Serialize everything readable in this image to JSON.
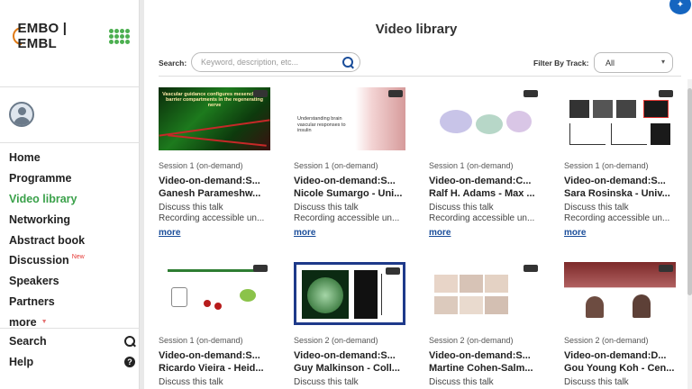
{
  "brand": {
    "logo_text": "EMBO | EMBL"
  },
  "sidebar": {
    "items": [
      {
        "label": "Home"
      },
      {
        "label": "Programme"
      },
      {
        "label": "Video library",
        "active": true
      },
      {
        "label": "Networking"
      },
      {
        "label": "Abstract book"
      },
      {
        "label": "Discussion",
        "badge": "New"
      },
      {
        "label": "Speakers"
      },
      {
        "label": "Partners"
      },
      {
        "label": "more"
      }
    ],
    "search_label": "Search",
    "help_label": "Help",
    "help_icon_glyph": "?"
  },
  "header": {
    "title": "Video library",
    "search_label": "Search:",
    "search_placeholder": "Keyword, description, etc...",
    "search_value": "",
    "filter_label": "Filter By Track:",
    "filter_value": "All"
  },
  "videos": [
    {
      "session": "Session 1 (on-demand)",
      "title": "Video-on-demand:S...",
      "speaker": "Ganesh Parameshw...",
      "discuss": "Discuss this talk",
      "access": "Recording accessible un...",
      "more": "more",
      "thumb_text": "Vascular guidance configures mesenchymal barrier compartments in the regenerating nerve"
    },
    {
      "session": "Session 1 (on-demand)",
      "title": "Video-on-demand:S...",
      "speaker": "Nicole Sumargo - Uni...",
      "discuss": "Discuss this talk",
      "access": "Recording accessible un...",
      "more": "more",
      "thumb_text": "Understanding brain vascular responses to insulin"
    },
    {
      "session": "Session 1 (on-demand)",
      "title": "Video-on-demand:C...",
      "speaker": "Ralf H. Adams - Max ...",
      "discuss": "Discuss this talk",
      "access": "Recording accessible un...",
      "more": "more",
      "thumb_text": ""
    },
    {
      "session": "Session 1 (on-demand)",
      "title": "Video-on-demand:S...",
      "speaker": "Sara Rosinska - Univ...",
      "discuss": "Discuss this talk",
      "access": "Recording accessible un...",
      "more": "more",
      "thumb_text": ""
    },
    {
      "session": "Session 1 (on-demand)",
      "title": "Video-on-demand:S...",
      "speaker": "Ricardo Vieira - Heid...",
      "discuss": "Discuss this talk",
      "access": "",
      "more": "",
      "thumb_text": ""
    },
    {
      "session": "Session 2 (on-demand)",
      "title": "Video-on-demand:S...",
      "speaker": "Guy Malkinson - Coll...",
      "discuss": "Discuss this talk",
      "access": "",
      "more": "",
      "thumb_text": ""
    },
    {
      "session": "Session 2 (on-demand)",
      "title": "Video-on-demand:S...",
      "speaker": "Martine Cohen-Salm...",
      "discuss": "Discuss this talk",
      "access": "",
      "more": "",
      "thumb_text": ""
    },
    {
      "session": "Session 2 (on-demand)",
      "title": "Video-on-demand:D...",
      "speaker": "Gou Young Koh - Cen...",
      "discuss": "Discuss this talk",
      "access": "",
      "more": "",
      "thumb_text": ""
    }
  ],
  "colors": {
    "accent_green": "#3aa14a",
    "link_blue": "#1a4d9a",
    "badge_red": "#e53935",
    "help_button_blue": "#1565c0"
  }
}
